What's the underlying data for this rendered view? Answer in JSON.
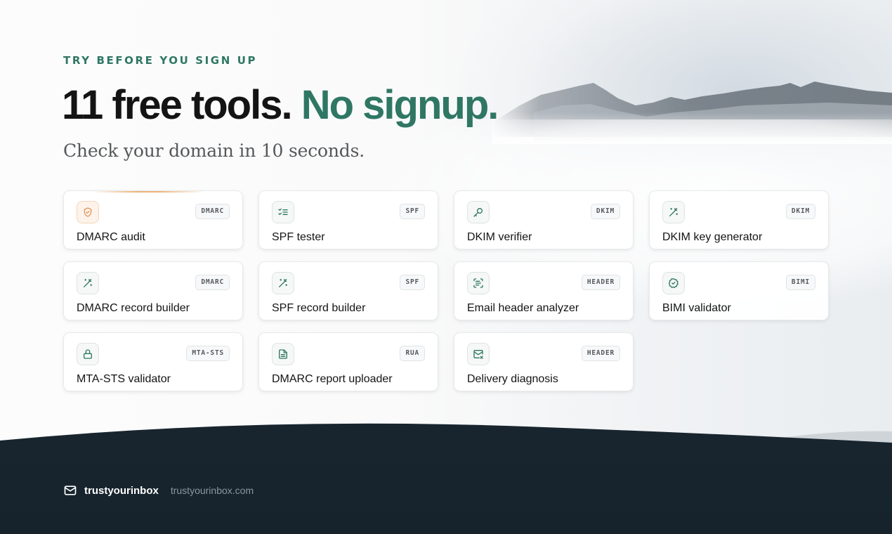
{
  "hero": {
    "eyebrow": "TRY BEFORE YOU SIGN UP",
    "headline_main": "11 free tools.",
    "headline_accent": "No signup.",
    "subheadline": "Check your domain in 10 seconds."
  },
  "tools": [
    {
      "title": "DMARC audit",
      "badge": "DMARC",
      "icon": "shield-icon"
    },
    {
      "title": "SPF tester",
      "badge": "SPF",
      "icon": "checklist-icon"
    },
    {
      "title": "DKIM verifier",
      "badge": "DKIM",
      "icon": "key-icon"
    },
    {
      "title": "DKIM key generator",
      "badge": "DKIM",
      "icon": "magic-wand-icon"
    },
    {
      "title": "DMARC record builder",
      "badge": "DMARC",
      "icon": "magic-wand-icon"
    },
    {
      "title": "SPF record builder",
      "badge": "SPF",
      "icon": "magic-wand-icon"
    },
    {
      "title": "Email header analyzer",
      "badge": "HEADER",
      "icon": "scan-text-icon"
    },
    {
      "title": "BIMI validator",
      "badge": "BIMI",
      "icon": "badge-check-icon"
    },
    {
      "title": "MTA-STS validator",
      "badge": "MTA-STS",
      "icon": "lock-icon"
    },
    {
      "title": "DMARC report uploader",
      "badge": "RUA",
      "icon": "file-icon"
    },
    {
      "title": "Delivery diagnosis",
      "badge": "HEADER",
      "icon": "mail-x-icon"
    }
  ],
  "footer": {
    "brand": "trustyourinbox",
    "url": "trustyourinbox.com",
    "icon": "mail-icon"
  },
  "colors": {
    "accent": "#2f7763",
    "highlight": "#eeb278",
    "footer_bg": "#17242e"
  }
}
